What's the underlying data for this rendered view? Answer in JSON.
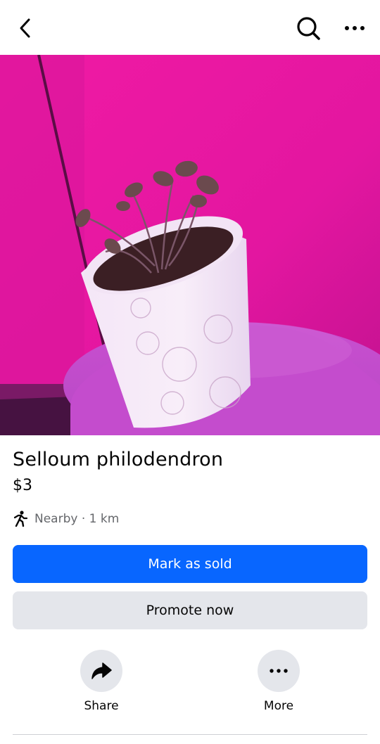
{
  "header": {
    "back_icon": "chevron-left-icon",
    "search_icon": "search-icon",
    "more_icon": "ellipsis-icon"
  },
  "listing": {
    "title": "Selloum philodendron",
    "price": "$3",
    "location": "Nearby · 1 km",
    "location_icon": "walking-person-icon"
  },
  "buttons": {
    "mark_sold": "Mark as sold",
    "promote": "Promote now"
  },
  "actions": [
    {
      "label": "Share",
      "icon": "share-arrow-icon"
    },
    {
      "label": "More",
      "icon": "ellipsis-icon"
    }
  ],
  "colors": {
    "primary": "#0866ff",
    "secondary_bg": "#e4e6eb",
    "muted_text": "#65676b"
  }
}
